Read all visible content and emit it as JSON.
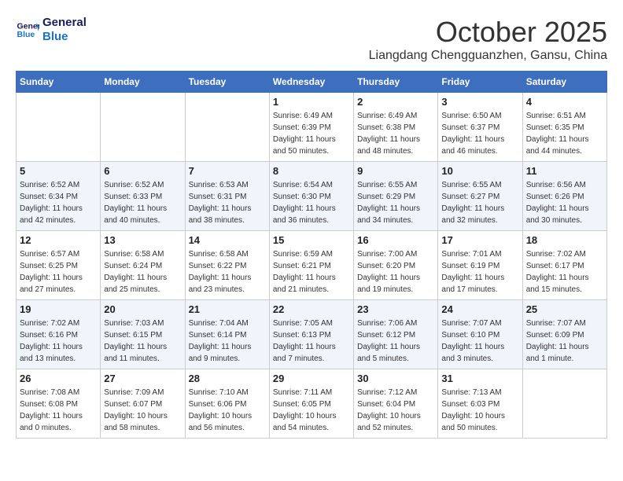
{
  "header": {
    "logo_line1": "General",
    "logo_line2": "Blue",
    "month_title": "October 2025",
    "location": "Liangdang Chengguanzhen, Gansu, China"
  },
  "weekdays": [
    "Sunday",
    "Monday",
    "Tuesday",
    "Wednesday",
    "Thursday",
    "Friday",
    "Saturday"
  ],
  "weeks": [
    [
      {
        "day": "",
        "sunrise": "",
        "sunset": "",
        "daylight": ""
      },
      {
        "day": "",
        "sunrise": "",
        "sunset": "",
        "daylight": ""
      },
      {
        "day": "",
        "sunrise": "",
        "sunset": "",
        "daylight": ""
      },
      {
        "day": "1",
        "sunrise": "Sunrise: 6:49 AM",
        "sunset": "Sunset: 6:39 PM",
        "daylight": "Daylight: 11 hours and 50 minutes."
      },
      {
        "day": "2",
        "sunrise": "Sunrise: 6:49 AM",
        "sunset": "Sunset: 6:38 PM",
        "daylight": "Daylight: 11 hours and 48 minutes."
      },
      {
        "day": "3",
        "sunrise": "Sunrise: 6:50 AM",
        "sunset": "Sunset: 6:37 PM",
        "daylight": "Daylight: 11 hours and 46 minutes."
      },
      {
        "day": "4",
        "sunrise": "Sunrise: 6:51 AM",
        "sunset": "Sunset: 6:35 PM",
        "daylight": "Daylight: 11 hours and 44 minutes."
      }
    ],
    [
      {
        "day": "5",
        "sunrise": "Sunrise: 6:52 AM",
        "sunset": "Sunset: 6:34 PM",
        "daylight": "Daylight: 11 hours and 42 minutes."
      },
      {
        "day": "6",
        "sunrise": "Sunrise: 6:52 AM",
        "sunset": "Sunset: 6:33 PM",
        "daylight": "Daylight: 11 hours and 40 minutes."
      },
      {
        "day": "7",
        "sunrise": "Sunrise: 6:53 AM",
        "sunset": "Sunset: 6:31 PM",
        "daylight": "Daylight: 11 hours and 38 minutes."
      },
      {
        "day": "8",
        "sunrise": "Sunrise: 6:54 AM",
        "sunset": "Sunset: 6:30 PM",
        "daylight": "Daylight: 11 hours and 36 minutes."
      },
      {
        "day": "9",
        "sunrise": "Sunrise: 6:55 AM",
        "sunset": "Sunset: 6:29 PM",
        "daylight": "Daylight: 11 hours and 34 minutes."
      },
      {
        "day": "10",
        "sunrise": "Sunrise: 6:55 AM",
        "sunset": "Sunset: 6:27 PM",
        "daylight": "Daylight: 11 hours and 32 minutes."
      },
      {
        "day": "11",
        "sunrise": "Sunrise: 6:56 AM",
        "sunset": "Sunset: 6:26 PM",
        "daylight": "Daylight: 11 hours and 30 minutes."
      }
    ],
    [
      {
        "day": "12",
        "sunrise": "Sunrise: 6:57 AM",
        "sunset": "Sunset: 6:25 PM",
        "daylight": "Daylight: 11 hours and 27 minutes."
      },
      {
        "day": "13",
        "sunrise": "Sunrise: 6:58 AM",
        "sunset": "Sunset: 6:24 PM",
        "daylight": "Daylight: 11 hours and 25 minutes."
      },
      {
        "day": "14",
        "sunrise": "Sunrise: 6:58 AM",
        "sunset": "Sunset: 6:22 PM",
        "daylight": "Daylight: 11 hours and 23 minutes."
      },
      {
        "day": "15",
        "sunrise": "Sunrise: 6:59 AM",
        "sunset": "Sunset: 6:21 PM",
        "daylight": "Daylight: 11 hours and 21 minutes."
      },
      {
        "day": "16",
        "sunrise": "Sunrise: 7:00 AM",
        "sunset": "Sunset: 6:20 PM",
        "daylight": "Daylight: 11 hours and 19 minutes."
      },
      {
        "day": "17",
        "sunrise": "Sunrise: 7:01 AM",
        "sunset": "Sunset: 6:19 PM",
        "daylight": "Daylight: 11 hours and 17 minutes."
      },
      {
        "day": "18",
        "sunrise": "Sunrise: 7:02 AM",
        "sunset": "Sunset: 6:17 PM",
        "daylight": "Daylight: 11 hours and 15 minutes."
      }
    ],
    [
      {
        "day": "19",
        "sunrise": "Sunrise: 7:02 AM",
        "sunset": "Sunset: 6:16 PM",
        "daylight": "Daylight: 11 hours and 13 minutes."
      },
      {
        "day": "20",
        "sunrise": "Sunrise: 7:03 AM",
        "sunset": "Sunset: 6:15 PM",
        "daylight": "Daylight: 11 hours and 11 minutes."
      },
      {
        "day": "21",
        "sunrise": "Sunrise: 7:04 AM",
        "sunset": "Sunset: 6:14 PM",
        "daylight": "Daylight: 11 hours and 9 minutes."
      },
      {
        "day": "22",
        "sunrise": "Sunrise: 7:05 AM",
        "sunset": "Sunset: 6:13 PM",
        "daylight": "Daylight: 11 hours and 7 minutes."
      },
      {
        "day": "23",
        "sunrise": "Sunrise: 7:06 AM",
        "sunset": "Sunset: 6:12 PM",
        "daylight": "Daylight: 11 hours and 5 minutes."
      },
      {
        "day": "24",
        "sunrise": "Sunrise: 7:07 AM",
        "sunset": "Sunset: 6:10 PM",
        "daylight": "Daylight: 11 hours and 3 minutes."
      },
      {
        "day": "25",
        "sunrise": "Sunrise: 7:07 AM",
        "sunset": "Sunset: 6:09 PM",
        "daylight": "Daylight: 11 hours and 1 minute."
      }
    ],
    [
      {
        "day": "26",
        "sunrise": "Sunrise: 7:08 AM",
        "sunset": "Sunset: 6:08 PM",
        "daylight": "Daylight: 11 hours and 0 minutes."
      },
      {
        "day": "27",
        "sunrise": "Sunrise: 7:09 AM",
        "sunset": "Sunset: 6:07 PM",
        "daylight": "Daylight: 10 hours and 58 minutes."
      },
      {
        "day": "28",
        "sunrise": "Sunrise: 7:10 AM",
        "sunset": "Sunset: 6:06 PM",
        "daylight": "Daylight: 10 hours and 56 minutes."
      },
      {
        "day": "29",
        "sunrise": "Sunrise: 7:11 AM",
        "sunset": "Sunset: 6:05 PM",
        "daylight": "Daylight: 10 hours and 54 minutes."
      },
      {
        "day": "30",
        "sunrise": "Sunrise: 7:12 AM",
        "sunset": "Sunset: 6:04 PM",
        "daylight": "Daylight: 10 hours and 52 minutes."
      },
      {
        "day": "31",
        "sunrise": "Sunrise: 7:13 AM",
        "sunset": "Sunset: 6:03 PM",
        "daylight": "Daylight: 10 hours and 50 minutes."
      },
      {
        "day": "",
        "sunrise": "",
        "sunset": "",
        "daylight": ""
      }
    ]
  ]
}
